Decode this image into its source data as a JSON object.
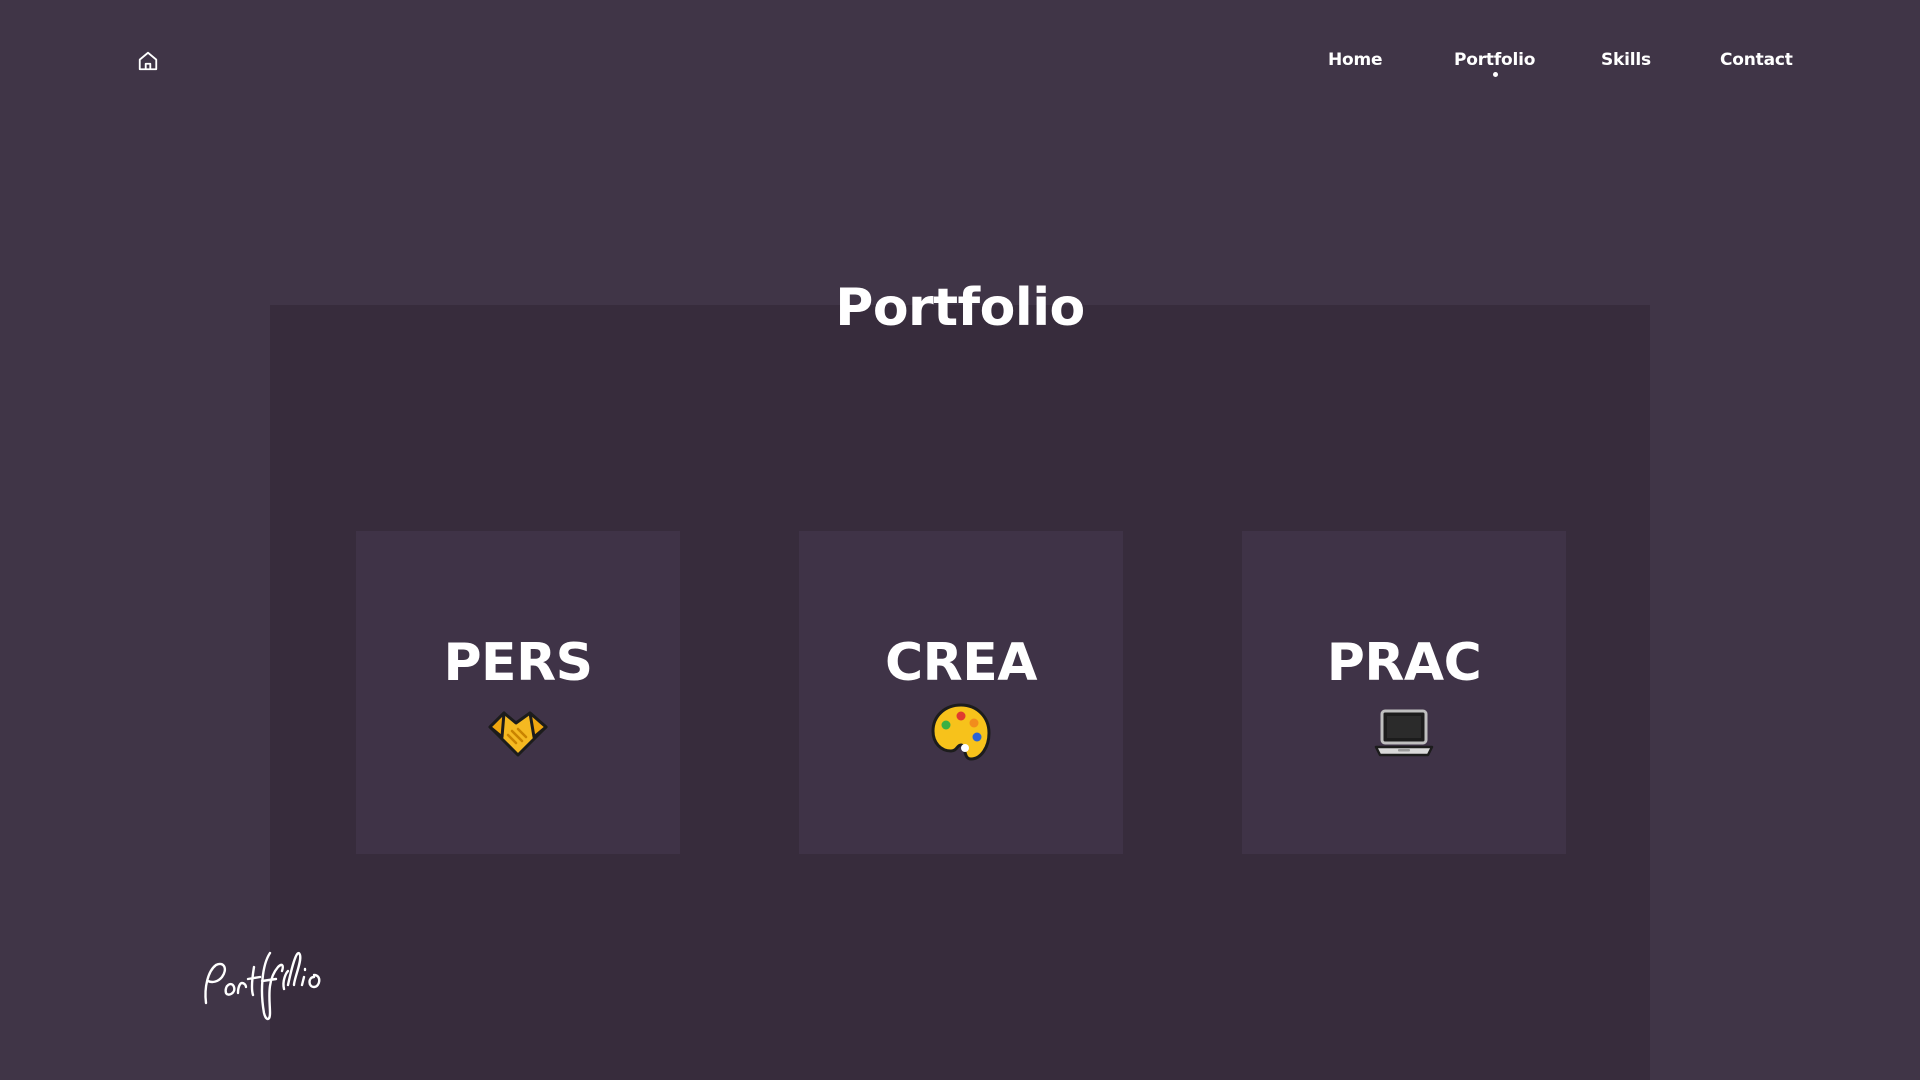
{
  "header": {
    "home_icon": "home-icon",
    "nav": [
      {
        "label": "Home",
        "active": false
      },
      {
        "label": "Portfolio",
        "active": true
      },
      {
        "label": "Skills",
        "active": false
      },
      {
        "label": "Contact",
        "active": false
      }
    ]
  },
  "main": {
    "title": "Portfolio",
    "cards": [
      {
        "label": "PERS",
        "icon": "handshake-icon"
      },
      {
        "label": "CREA",
        "icon": "palette-icon"
      },
      {
        "label": "PRAC",
        "icon": "laptop-icon"
      }
    ]
  },
  "signature": {
    "text": "Portfolio"
  },
  "colors": {
    "background": "#403547",
    "panel": "#372c3c",
    "card": "#3f3347",
    "text": "#ffffff"
  }
}
